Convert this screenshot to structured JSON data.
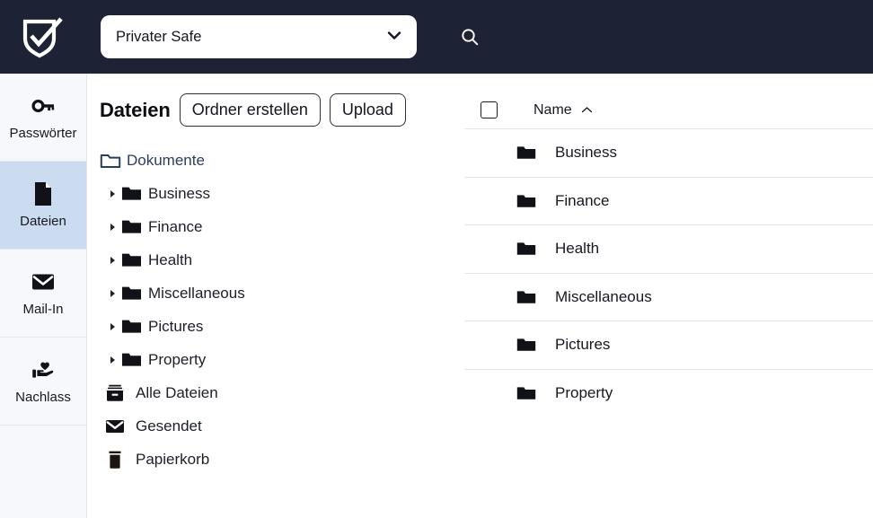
{
  "header": {
    "logo_name": "shield-check-logo",
    "safe_selector": {
      "value": "Privater Safe",
      "icon": "chevron-down-icon"
    },
    "search_icon": "search-icon"
  },
  "sidebar": {
    "items": [
      {
        "label": "Passwörter",
        "icon": "key-icon",
        "active": false
      },
      {
        "label": "Dateien",
        "icon": "file-icon",
        "active": true
      },
      {
        "label": "Mail-In",
        "icon": "envelope-icon",
        "active": false
      },
      {
        "label": "Nachlass",
        "icon": "hand-heart-icon",
        "active": false
      }
    ]
  },
  "files_panel": {
    "title": "Dateien",
    "create_folder_label": "Ordner erstellen",
    "upload_label": "Upload",
    "root": {
      "label": "Dokumente",
      "icon": "folder-outline-icon"
    },
    "folders": [
      {
        "label": "Business",
        "icon": "folder-icon",
        "caret": "caret-right-icon"
      },
      {
        "label": "Finance",
        "icon": "folder-icon",
        "caret": "caret-right-icon"
      },
      {
        "label": "Health",
        "icon": "folder-icon",
        "caret": "caret-right-icon"
      },
      {
        "label": "Miscellaneous",
        "icon": "folder-icon",
        "caret": "caret-right-icon"
      },
      {
        "label": "Pictures",
        "icon": "folder-icon",
        "caret": "caret-right-icon"
      },
      {
        "label": "Property",
        "icon": "folder-icon",
        "caret": "caret-right-icon"
      }
    ],
    "special": [
      {
        "label": "Alle Dateien",
        "icon": "archive-icon"
      },
      {
        "label": "Gesendet",
        "icon": "envelope-icon"
      },
      {
        "label": "Papierkorb",
        "icon": "trash-icon"
      }
    ]
  },
  "table": {
    "select_all_checked": false,
    "columns": [
      {
        "label": "Name",
        "sort": "asc",
        "sort_icon": "caret-up-icon"
      }
    ],
    "rows": [
      {
        "name": "Business",
        "icon": "folder-icon"
      },
      {
        "name": "Finance",
        "icon": "folder-icon"
      },
      {
        "name": "Health",
        "icon": "folder-icon"
      },
      {
        "name": "Miscellaneous",
        "icon": "folder-icon"
      },
      {
        "name": "Pictures",
        "icon": "folder-icon"
      },
      {
        "name": "Property",
        "icon": "folder-icon"
      }
    ]
  },
  "colors": {
    "header_bg": "#1e2235",
    "nav_bg": "#f6f8fc",
    "nav_active_bg": "#ccdcf0",
    "root_text": "#2c3e5c",
    "border": "#e6e6e6"
  }
}
